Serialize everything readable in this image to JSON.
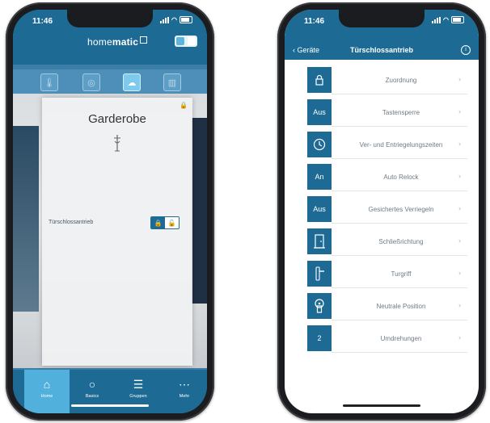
{
  "left": {
    "time": "11:46",
    "brand_light": "home",
    "brand_bold": "matic",
    "room_title": "Garderobe",
    "lock_label": "Türschlossantrieb",
    "tabs": [
      {
        "label": "Home",
        "icon": "home-icon",
        "active": true
      },
      {
        "label": "Basics",
        "icon": "basics-icon"
      },
      {
        "label": "Gruppen",
        "icon": "groups-icon"
      },
      {
        "label": "Mehr",
        "icon": "more-icon"
      }
    ]
  },
  "right": {
    "time": "11:46",
    "back_label": "Geräte",
    "title": "Türschlossantrieb",
    "items": [
      {
        "label": "Zuordnung",
        "box": "",
        "icon": "lock-icon"
      },
      {
        "label": "Tastensperre",
        "box": "Aus"
      },
      {
        "label": "Ver- und Entriegelungszeiten",
        "box": "",
        "icon": "clock-icon"
      },
      {
        "label": "Auto Relock",
        "box": "An"
      },
      {
        "label": "Gesichertes Verriegeln",
        "box": "Aus"
      },
      {
        "label": "Schließrichtung",
        "box": "",
        "icon": "door-icon"
      },
      {
        "label": "Turgriff",
        "box": "",
        "icon": "door-handle-icon"
      },
      {
        "label": "Neutrale Position",
        "box": "",
        "icon": "lock-cylinder-icon"
      },
      {
        "label": "Umdrehungen",
        "box": "2"
      }
    ]
  },
  "colors": {
    "primary": "#1d6a94",
    "accent": "#52b0dc",
    "text_muted": "#6c7b86"
  }
}
